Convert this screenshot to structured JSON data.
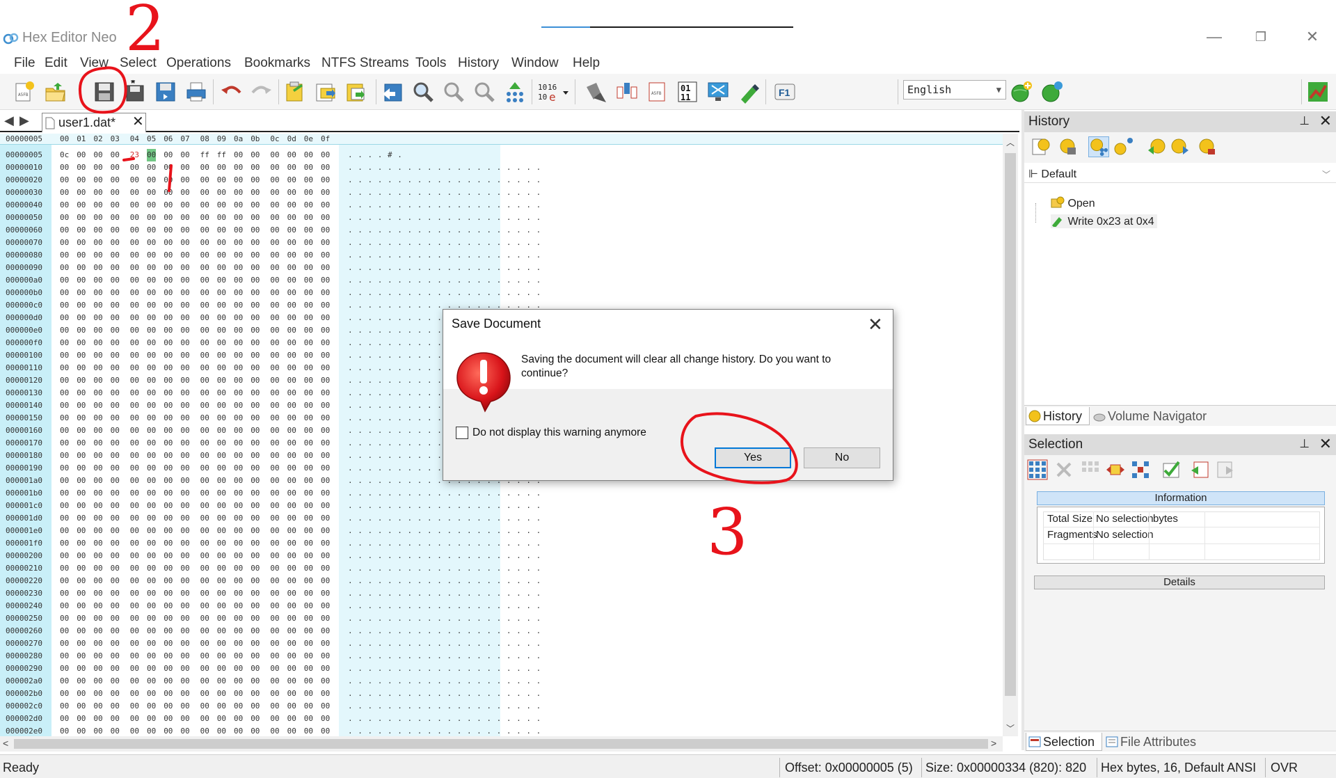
{
  "app": {
    "title": "Hex Editor Neo",
    "window_controls": {
      "minimize": "—",
      "restore": "❐",
      "close": "✕"
    }
  },
  "menu": [
    "File",
    "Edit",
    "View",
    "Select",
    "Operations",
    "Bookmarks",
    "NTFS Streams",
    "Tools",
    "History",
    "Window",
    "Help"
  ],
  "toolbar": {
    "icons": [
      "new-file-icon",
      "open-file-icon",
      "save-icon",
      "save-as-icon",
      "save-all-icon",
      "print-icon",
      "undo-icon",
      "redo-icon",
      "copy-icon",
      "paste-icon",
      "paste-special-icon",
      "goto-icon",
      "find-icon",
      "find-next-icon",
      "find-prev-icon",
      "find-all-icon",
      "columns-icon",
      "encoding-icon",
      "bits-icon",
      "structure-icon",
      "bytes-icon",
      "binary-icon",
      "screen-icon",
      "pattern-icon",
      "help-icon"
    ],
    "language": "English",
    "extra_icons": [
      "add-globe-icon",
      "globe-icon",
      "chart-icon"
    ]
  },
  "document_tab": {
    "label": "user1.dat*",
    "close": "✕"
  },
  "hex": {
    "header_offset": "00000005",
    "header_columns": [
      "00",
      "01",
      "02",
      "03",
      "04",
      "05",
      "06",
      "07",
      "08",
      "09",
      "0a",
      "0b",
      "0c",
      "0d",
      "0e",
      "0f"
    ],
    "first_row_offset": "00000005",
    "first_row_bytes": [
      "0c",
      "00",
      "00",
      "00",
      "23",
      "00",
      "00",
      "00",
      "ff",
      "ff",
      "00",
      "00",
      "00",
      "00",
      "00",
      "00"
    ],
    "first_row_text": ". . . . # .",
    "row_offsets": [
      "00000010",
      "00000020",
      "00000030",
      "00000040",
      "00000050",
      "00000060",
      "00000070",
      "00000080",
      "00000090",
      "000000a0",
      "000000b0",
      "000000c0",
      "000000d0",
      "000000e0",
      "000000f0",
      "00000100",
      "00000110",
      "00000120",
      "00000130",
      "00000140",
      "00000150",
      "00000160",
      "00000170",
      "00000180",
      "00000190",
      "000001a0",
      "000001b0",
      "000001c0",
      "000001d0",
      "000001e0",
      "000001f0",
      "00000200",
      "00000210",
      "00000220",
      "00000230",
      "00000240",
      "00000250",
      "00000260",
      "00000270",
      "00000280",
      "00000290",
      "000002a0",
      "000002b0",
      "000002c0",
      "000002d0",
      "000002e0"
    ],
    "zero_byte": "00",
    "dot_text": ". . . . . . . . . . . . . . . . . . . ."
  },
  "history_panel": {
    "title": "History",
    "pin": "📌",
    "close": "✕",
    "group": "Default",
    "entries": [
      "Open",
      "Write 0x23 at 0x4"
    ],
    "tabs": [
      "History",
      "Volume Navigator"
    ]
  },
  "selection_panel": {
    "title": "Selection",
    "info_header": "Information",
    "rows": [
      {
        "label": "Total Size",
        "value": "No selection",
        "unit": "bytes"
      },
      {
        "label": "Fragments",
        "value": "No selection",
        "unit": ""
      }
    ],
    "details_header": "Details",
    "tabs": [
      "Selection",
      "File Attributes"
    ]
  },
  "status": {
    "ready": "Ready",
    "offset": "Offset: 0x00000005 (5)",
    "size": "Size: 0x00000334 (820): 820",
    "mode": "Hex bytes, 16, Default ANSI",
    "ovr": "OVR"
  },
  "dialog": {
    "title": "Save Document",
    "message": "Saving the document will clear all change history. Do you want to continue?",
    "checkbox_label": "Do not display this warning anymore",
    "yes": "Yes",
    "no": "No",
    "close": "✕"
  },
  "annotations": {
    "step1": "1",
    "step2": "2",
    "step3": "3",
    "color": "#e8131b"
  }
}
